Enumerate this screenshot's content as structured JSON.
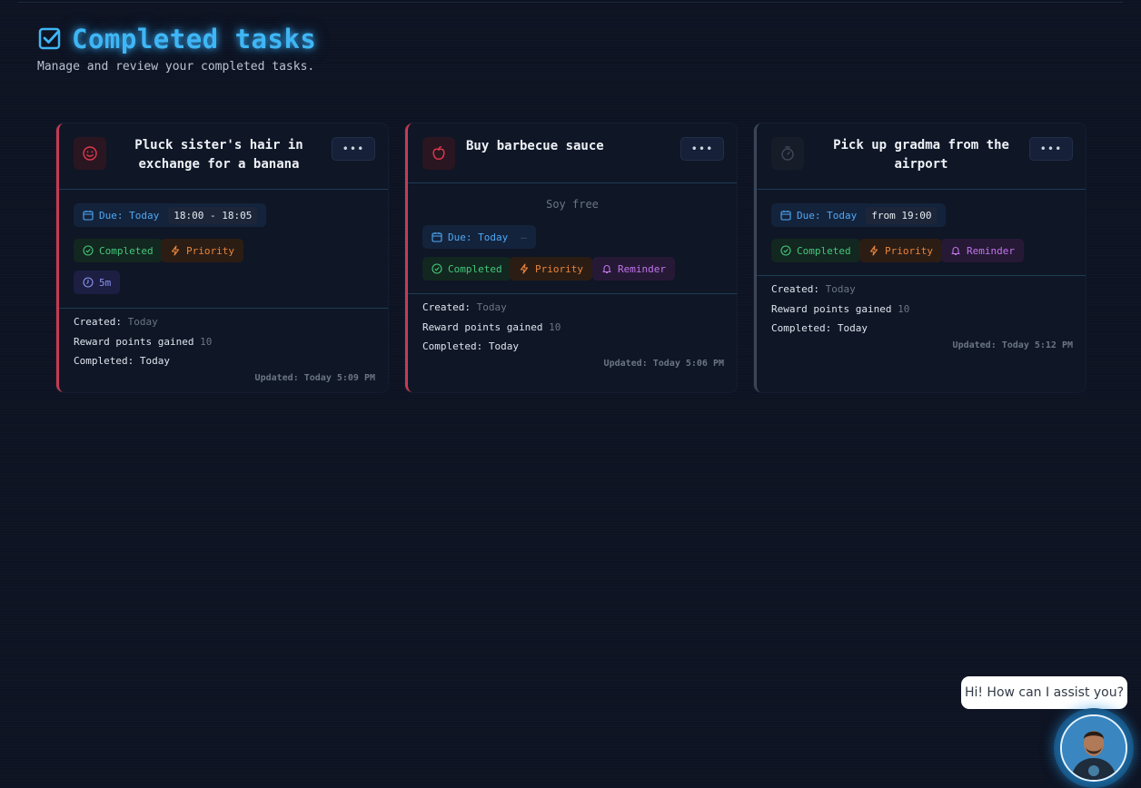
{
  "header": {
    "title": "Completed tasks",
    "subtitle": "Manage and review your completed tasks."
  },
  "menu_label": "•••",
  "colors": {
    "accent": "#3fb6f5",
    "card_red": "#c73a53",
    "card_grey": "#3b4658",
    "completed": "#45c77c",
    "priority": "#e8843c",
    "reminder": "#c174ea"
  },
  "tasks": [
    {
      "icon": "smile-icon",
      "title_line1": "Pluck sister's hair in",
      "title_line2": "exchange for a banana",
      "due_label": "Due: Today",
      "due_time": "18:00 - 18:05",
      "status": "Completed",
      "priority": "Priority",
      "duration": "5m",
      "created_label": "Created:",
      "created_value": "Today",
      "reward_label": "Reward points gained",
      "reward_value": "10",
      "completed_label": "Completed: Today",
      "updated": "Updated: Today 5:09 PM"
    },
    {
      "icon": "apple-icon",
      "title": "Buy barbecue sauce",
      "notes": "Soy free",
      "due_label": "Due: Today",
      "due_time": "—",
      "status": "Completed",
      "priority": "Priority",
      "reminder": "Reminder",
      "created_label": "Created:",
      "created_value": "Today",
      "reward_label": "Reward points gained",
      "reward_value": "10",
      "completed_label": "Completed: Today",
      "updated": "Updated: Today 5:06 PM"
    },
    {
      "icon": "timer-icon",
      "title_line1": "Pick up gradma from the",
      "title_line2": "airport",
      "due_label": "Due: Today",
      "due_time": "from 19:00",
      "status": "Completed",
      "priority": "Priority",
      "reminder": "Reminder",
      "created_label": "Created:",
      "created_value": "Today",
      "reward_label": "Reward points gained",
      "reward_value": "10",
      "completed_label": "Completed: Today",
      "updated": "Updated: Today 5:12 PM"
    }
  ],
  "chat": {
    "greeting": "Hi! How can I assist you?"
  }
}
